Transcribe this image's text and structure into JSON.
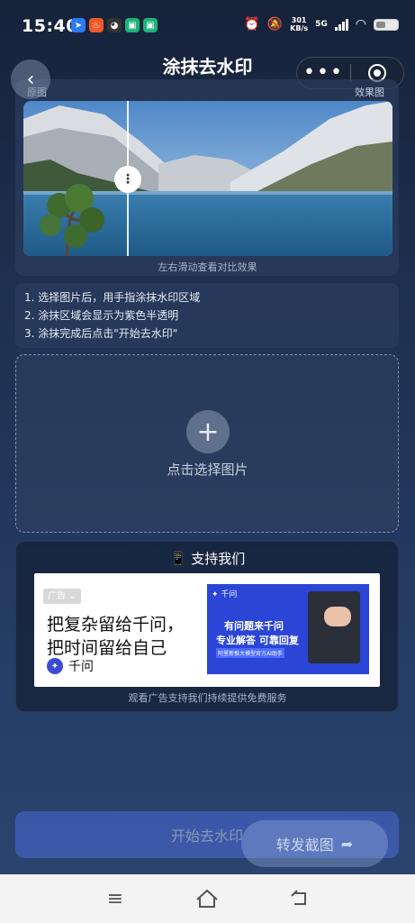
{
  "status_bar": {
    "time": "15:40",
    "net_speed_value": "301",
    "net_speed_unit": "KB/s",
    "network": "5G"
  },
  "header": {
    "title": "涂抹去水印"
  },
  "compare": {
    "label_left": "原图",
    "label_right": "效果图",
    "hint": "左右滑动查看对比效果"
  },
  "instructions": [
    "1. 选择图片后，用手指涂抹水印区域",
    "2. 涂抹区域会显示为紫色半透明",
    "3. 涂抹完成后点击\"开始去水印\""
  ],
  "upload": {
    "label": "点击选择图片"
  },
  "support": {
    "icon": "📱",
    "title": "支持我们",
    "hint": "观看广告支持我们持续提供免费服务",
    "ad": {
      "badge": "广告",
      "line1": "把复杂留给千问，",
      "line2": "把时间留给自己",
      "brand": "千问",
      "visual_brand": "千问",
      "visual_h1": "有问题来千问",
      "visual_h2": "专业解答 可靠回复",
      "visual_tag": "阿里新推大模型官方AI助手"
    }
  },
  "actions": {
    "start_label": "开始去水印",
    "share_label": "转发截图"
  },
  "colors": {
    "accent": "#4b6bd9",
    "background_top": "#16223a",
    "background_bottom": "#2b4672"
  }
}
